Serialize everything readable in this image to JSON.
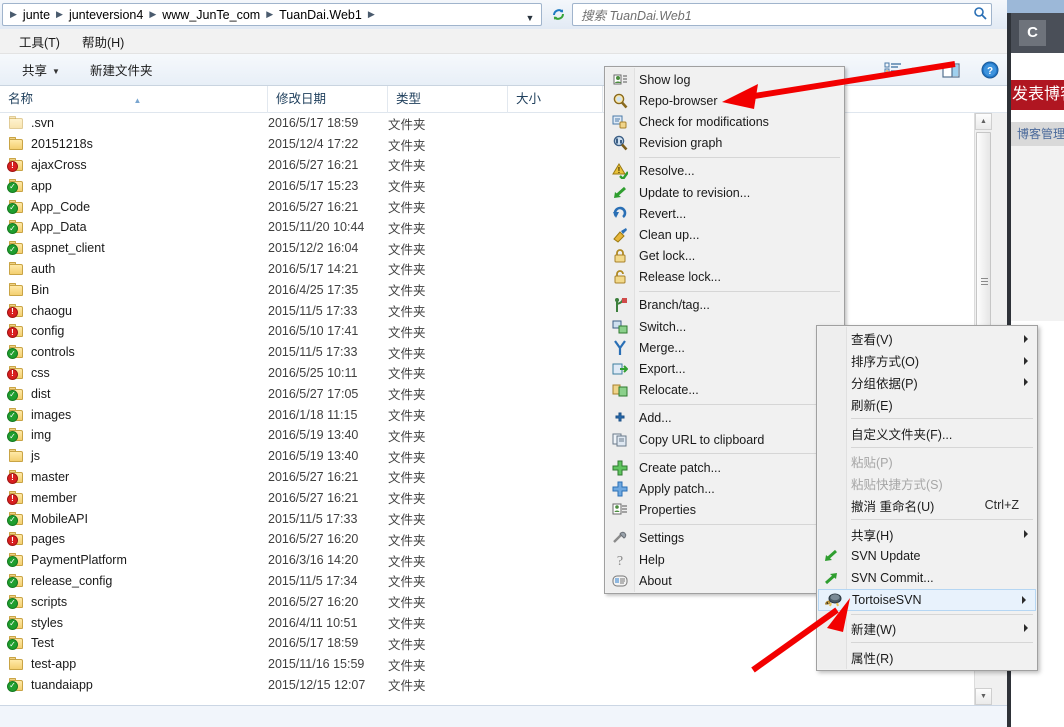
{
  "address_bar": {
    "breadcrumbs": [
      "junte",
      "junteversion4",
      "www_JunTe_com",
      "TuanDai.Web1"
    ],
    "dropdown_icon": "chevron-down-icon",
    "refresh_icon": "refresh-icon",
    "search_placeholder": "搜索 TuanDai.Web1",
    "search_value": "",
    "search_icon": "search-icon"
  },
  "menubar": {
    "items": [
      {
        "label": "工具(T)"
      },
      {
        "label": "帮助(H)"
      }
    ]
  },
  "commandbar": {
    "share_label": "共享",
    "new_folder_label": "新建文件夹",
    "view_icon": "list-view-icon",
    "view_dropdown_icon": "chevron-down-icon",
    "preview_pane_icon": "preview-pane-icon",
    "help_icon": "help-icon"
  },
  "columns": [
    {
      "key": "name",
      "label": "名称",
      "sorted": true,
      "sort_dir": "asc"
    },
    {
      "key": "date",
      "label": "修改日期"
    },
    {
      "key": "type",
      "label": "类型"
    },
    {
      "key": "size",
      "label": "大小"
    }
  ],
  "files": [
    {
      "name": ".svn",
      "date": "2016/5/17 18:59",
      "type": "文件夹",
      "size": "",
      "icon": "folder-icon",
      "overlay": "none",
      "dim": true
    },
    {
      "name": "20151218s",
      "date": "2015/12/4 17:22",
      "type": "文件夹",
      "size": "",
      "icon": "folder-icon",
      "overlay": "none",
      "dim": false
    },
    {
      "name": "ajaxCross",
      "date": "2016/5/27 16:21",
      "type": "文件夹",
      "size": "",
      "icon": "folder-icon",
      "overlay": "red",
      "dim": false
    },
    {
      "name": "app",
      "date": "2016/5/17 15:23",
      "type": "文件夹",
      "size": "",
      "icon": "folder-icon",
      "overlay": "green",
      "dim": false
    },
    {
      "name": "App_Code",
      "date": "2016/5/27 16:21",
      "type": "文件夹",
      "size": "",
      "icon": "folder-icon",
      "overlay": "green",
      "dim": false
    },
    {
      "name": "App_Data",
      "date": "2015/11/20 10:44",
      "type": "文件夹",
      "size": "",
      "icon": "folder-icon",
      "overlay": "green",
      "dim": false
    },
    {
      "name": "aspnet_client",
      "date": "2015/12/2 16:04",
      "type": "文件夹",
      "size": "",
      "icon": "folder-icon",
      "overlay": "green",
      "dim": false
    },
    {
      "name": "auth",
      "date": "2016/5/17 14:21",
      "type": "文件夹",
      "size": "",
      "icon": "folder-icon",
      "overlay": "none",
      "dim": false
    },
    {
      "name": "Bin",
      "date": "2016/4/25 17:35",
      "type": "文件夹",
      "size": "",
      "icon": "folder-icon",
      "overlay": "none",
      "dim": false
    },
    {
      "name": "chaogu",
      "date": "2015/11/5 17:33",
      "type": "文件夹",
      "size": "",
      "icon": "folder-icon",
      "overlay": "red",
      "dim": false
    },
    {
      "name": "config",
      "date": "2016/5/10 17:41",
      "type": "文件夹",
      "size": "",
      "icon": "folder-icon",
      "overlay": "red",
      "dim": false
    },
    {
      "name": "controls",
      "date": "2015/11/5 17:33",
      "type": "文件夹",
      "size": "",
      "icon": "folder-icon",
      "overlay": "green",
      "dim": false
    },
    {
      "name": "css",
      "date": "2016/5/25 10:11",
      "type": "文件夹",
      "size": "",
      "icon": "folder-icon",
      "overlay": "red",
      "dim": false
    },
    {
      "name": "dist",
      "date": "2016/5/27 17:05",
      "type": "文件夹",
      "size": "",
      "icon": "folder-icon",
      "overlay": "green",
      "dim": false
    },
    {
      "name": "images",
      "date": "2016/1/18 11:15",
      "type": "文件夹",
      "size": "",
      "icon": "folder-icon",
      "overlay": "green",
      "dim": false
    },
    {
      "name": "img",
      "date": "2016/5/19 13:40",
      "type": "文件夹",
      "size": "",
      "icon": "folder-icon",
      "overlay": "green",
      "dim": false
    },
    {
      "name": "js",
      "date": "2016/5/19 13:40",
      "type": "文件夹",
      "size": "",
      "icon": "folder-icon",
      "overlay": "none",
      "dim": false
    },
    {
      "name": "master",
      "date": "2016/5/27 16:21",
      "type": "文件夹",
      "size": "",
      "icon": "folder-icon",
      "overlay": "red",
      "dim": false
    },
    {
      "name": "member",
      "date": "2016/5/27 16:21",
      "type": "文件夹",
      "size": "",
      "icon": "folder-icon",
      "overlay": "red",
      "dim": false
    },
    {
      "name": "MobileAPI",
      "date": "2015/11/5 17:33",
      "type": "文件夹",
      "size": "",
      "icon": "folder-icon",
      "overlay": "green",
      "dim": false
    },
    {
      "name": "pages",
      "date": "2016/5/27 16:20",
      "type": "文件夹",
      "size": "",
      "icon": "folder-icon",
      "overlay": "red",
      "dim": false
    },
    {
      "name": "PaymentPlatform",
      "date": "2016/3/16 14:20",
      "type": "文件夹",
      "size": "",
      "icon": "folder-icon",
      "overlay": "green",
      "dim": false
    },
    {
      "name": "release_config",
      "date": "2015/11/5 17:34",
      "type": "文件夹",
      "size": "",
      "icon": "folder-icon",
      "overlay": "green",
      "dim": false
    },
    {
      "name": "scripts",
      "date": "2016/5/27 16:20",
      "type": "文件夹",
      "size": "",
      "icon": "folder-icon",
      "overlay": "green",
      "dim": false
    },
    {
      "name": "styles",
      "date": "2016/4/11 10:51",
      "type": "文件夹",
      "size": "",
      "icon": "folder-icon",
      "overlay": "green",
      "dim": false
    },
    {
      "name": "Test",
      "date": "2016/5/17 18:59",
      "type": "文件夹",
      "size": "",
      "icon": "folder-icon",
      "overlay": "green",
      "dim": false
    },
    {
      "name": "test-app",
      "date": "2015/11/16 15:59",
      "type": "文件夹",
      "size": "",
      "icon": "folder-icon",
      "overlay": "none",
      "dim": false
    },
    {
      "name": "tuandaiapp",
      "date": "2015/12/15 12:07",
      "type": "文件夹",
      "size": "",
      "icon": "folder-icon",
      "overlay": "green",
      "dim": false
    }
  ],
  "tortoise_submenu": {
    "items": [
      {
        "label": "Show log",
        "icon": "show-log-icon",
        "type": "item"
      },
      {
        "label": "Repo-browser",
        "icon": "repo-browser-icon",
        "type": "item"
      },
      {
        "label": "Check for modifications",
        "icon": "check-mods-icon",
        "type": "item"
      },
      {
        "label": "Revision graph",
        "icon": "revision-graph-icon",
        "type": "item"
      },
      {
        "type": "separator"
      },
      {
        "label": "Resolve...",
        "icon": "resolve-icon",
        "type": "item"
      },
      {
        "label": "Update to revision...",
        "icon": "update-revision-icon",
        "type": "item"
      },
      {
        "label": "Revert...",
        "icon": "revert-icon",
        "type": "item"
      },
      {
        "label": "Clean up...",
        "icon": "cleanup-icon",
        "type": "item"
      },
      {
        "label": "Get lock...",
        "icon": "lock-closed-icon",
        "type": "item"
      },
      {
        "label": "Release lock...",
        "icon": "lock-open-icon",
        "type": "item"
      },
      {
        "type": "separator"
      },
      {
        "label": "Branch/tag...",
        "icon": "branch-tag-icon",
        "type": "item"
      },
      {
        "label": "Switch...",
        "icon": "switch-icon",
        "type": "item"
      },
      {
        "label": "Merge...",
        "icon": "merge-icon",
        "type": "item"
      },
      {
        "label": "Export...",
        "icon": "export-icon",
        "type": "item"
      },
      {
        "label": "Relocate...",
        "icon": "relocate-icon",
        "type": "item"
      },
      {
        "type": "separator"
      },
      {
        "label": "Add...",
        "icon": "add-icon",
        "type": "item"
      },
      {
        "label": "Copy URL to clipboard",
        "icon": "copy-url-icon",
        "type": "item"
      },
      {
        "type": "separator"
      },
      {
        "label": "Create patch...",
        "icon": "create-patch-icon",
        "type": "item"
      },
      {
        "label": "Apply patch...",
        "icon": "apply-patch-icon",
        "type": "item"
      },
      {
        "label": "Properties",
        "icon": "properties-icon",
        "type": "item"
      },
      {
        "type": "separator"
      },
      {
        "label": "Settings",
        "icon": "settings-icon",
        "type": "item"
      },
      {
        "label": "Help",
        "icon": "help-icon",
        "type": "item"
      },
      {
        "label": "About",
        "icon": "about-icon",
        "type": "item"
      }
    ]
  },
  "context_menu": {
    "items": [
      {
        "label": "查看(V)",
        "type": "item",
        "submenu": true
      },
      {
        "label": "排序方式(O)",
        "type": "item",
        "submenu": true
      },
      {
        "label": "分组依据(P)",
        "type": "item",
        "submenu": true
      },
      {
        "label": "刷新(E)",
        "type": "item"
      },
      {
        "type": "separator"
      },
      {
        "label": "自定义文件夹(F)...",
        "type": "item"
      },
      {
        "type": "separator"
      },
      {
        "label": "粘贴(P)",
        "type": "item",
        "disabled": true
      },
      {
        "label": "粘贴快捷方式(S)",
        "type": "item",
        "disabled": true
      },
      {
        "label": "撤消 重命名(U)",
        "type": "item",
        "accel": "Ctrl+Z"
      },
      {
        "type": "separator"
      },
      {
        "label": "共享(H)",
        "type": "item",
        "submenu": true
      },
      {
        "label": "SVN Update",
        "type": "item",
        "icon": "svn-update-icon"
      },
      {
        "label": "SVN Commit...",
        "type": "item",
        "icon": "svn-commit-icon"
      },
      {
        "label": "TortoiseSVN",
        "type": "item",
        "submenu": true,
        "highlighted": true,
        "icon": "tortoise-icon"
      },
      {
        "type": "separator"
      },
      {
        "label": "新建(W)",
        "type": "item",
        "submenu": true
      },
      {
        "type": "separator"
      },
      {
        "label": "属性(R)",
        "type": "item"
      }
    ]
  },
  "background_browser": {
    "tab_glyph": "C",
    "banner_text": "发表博客",
    "subtitle_text": "博客管理"
  },
  "annotations": {
    "arrow_color": "#f20000",
    "arrow_top_target": "Repo-browser",
    "arrow_bottom_target": "TortoiseSVN"
  },
  "colors": {
    "accent": "#2a6fb5",
    "highlight_bg": "#e8f2fc",
    "highlight_border": "#b5d6f3",
    "overlay_green": "#1f9e2e",
    "overlay_red": "#d81f1f",
    "arrow_red": "#f20000"
  }
}
